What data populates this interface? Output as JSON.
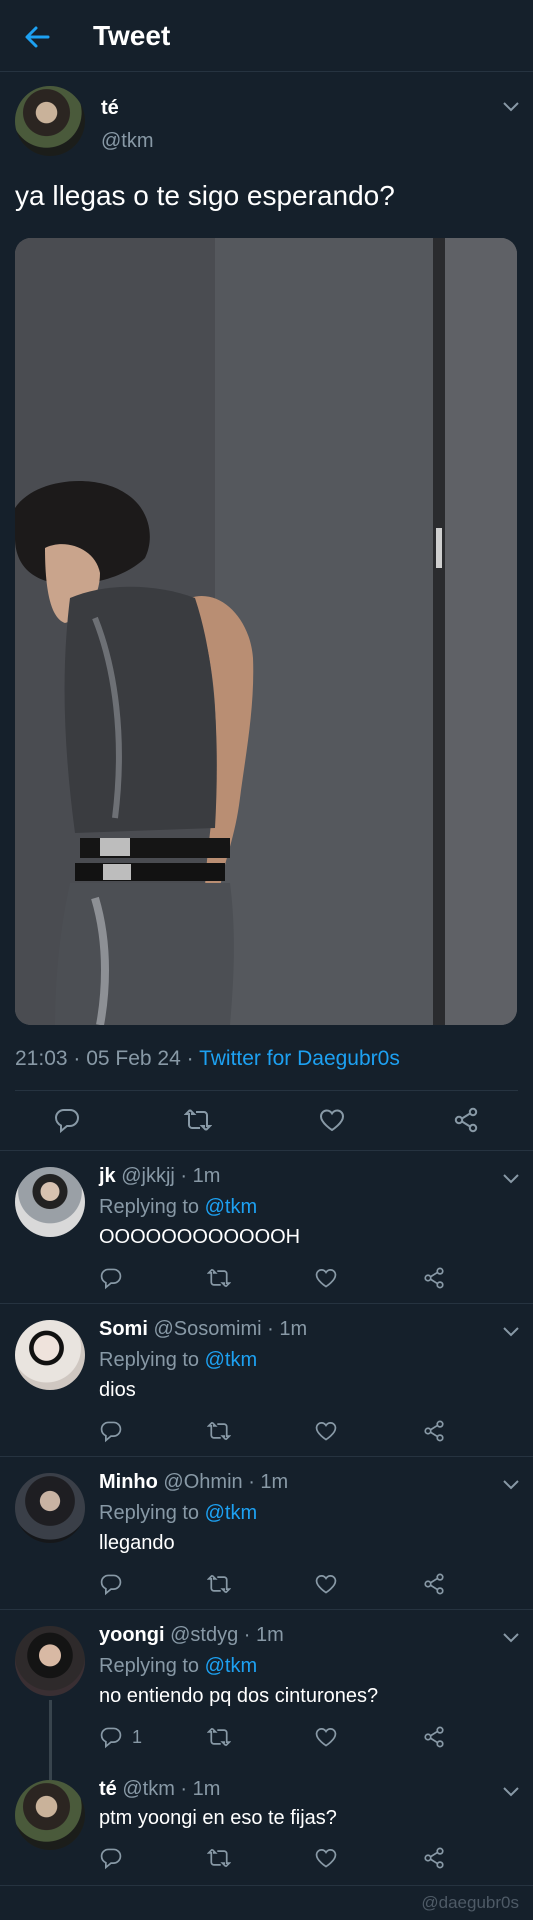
{
  "header": {
    "title": "Tweet",
    "back_icon": "arrow-left-icon"
  },
  "main_tweet": {
    "name": "té",
    "handle": "@tkm",
    "text": "ya llegas o te sigo esperando?",
    "time": "21:03 · 05 Feb 24 · ",
    "source": "Twitter for Daegubr0s"
  },
  "replies": [
    {
      "name": "jk",
      "meta": " @jkkjj · 1m",
      "replying_prefix": "Replying to ",
      "replying_to": "@tkm",
      "text": "OOOOOOOOOOOOH",
      "reply_count": ""
    },
    {
      "name": "Somi",
      "meta": " @Sosomimi · 1m",
      "replying_prefix": "Replying to ",
      "replying_to": "@tkm",
      "text": "dios",
      "reply_count": ""
    },
    {
      "name": "Minho",
      "meta": " @Ohmin · 1m",
      "replying_prefix": "Replying to ",
      "replying_to": "@tkm",
      "text": "llegando",
      "reply_count": ""
    },
    {
      "name": "yoongi",
      "meta": " @stdyg · 1m",
      "replying_prefix": "Replying to ",
      "replying_to": "@tkm",
      "text": "no entiendo pq dos cinturones?",
      "reply_count": "1"
    },
    {
      "name": "té",
      "meta": " @tkm · 1m",
      "text": "ptm yoongi en eso te fijas?",
      "reply_count": ""
    }
  ],
  "watermark": "@daegubr0s",
  "colors": {
    "background": "#15202b",
    "accent": "#1da1f2",
    "muted": "#8899a6",
    "divider": "#263340"
  }
}
